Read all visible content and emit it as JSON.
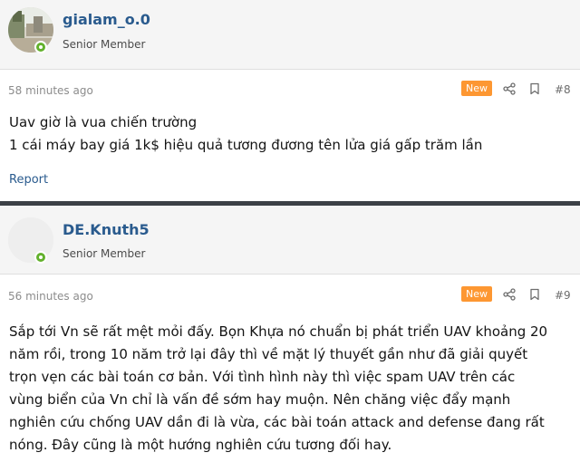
{
  "posts": [
    {
      "username": "gialam_o.0",
      "user_title": "Senior Member",
      "time": "58 minutes ago",
      "badge": "New",
      "post_number": "#8",
      "body_lines": [
        "Uav giờ là vua chiến trường",
        "1 cái máy bay giá 1k$ hiệu quả tương đương tên lửa giá gấp trăm lần"
      ],
      "report_label": "Report"
    },
    {
      "username": "DE.Knuth5",
      "user_title": "Senior Member",
      "time": "56 minutes ago",
      "badge": "New",
      "post_number": "#9",
      "body_lines": [
        "Sắp tới Vn sẽ rất mệt mỏi đấy. Bọn Khựa nó chuẩn bị phát triển UAV khoảng 20",
        "năm rồi, trong 10 năm trở lại đây thì về mặt lý thuyết gần như đã giải quyết",
        "trọn vẹn các bài toán cơ bản. Với tình hình này thì việc spam UAV trên các",
        "vùng biển của Vn chỉ là vấn đề sớm hay muộn. Nên chăng việc đẩy mạnh",
        "nghiên cứu chống UAV dần đi là vừa, các bài toán attack and defense đang rất",
        "nóng. Đây cũng là một hướng nghiên cứu tương đối hay."
      ]
    }
  ],
  "icons": {
    "share": "share-icon",
    "bookmark": "bookmark-icon",
    "online": "online-status-icon"
  },
  "colors": {
    "username": "#2a5b8e",
    "badge": "#fd9732",
    "online": "#63b12d",
    "divider": "#3c4046",
    "header_bg": "#f5f5f5"
  }
}
